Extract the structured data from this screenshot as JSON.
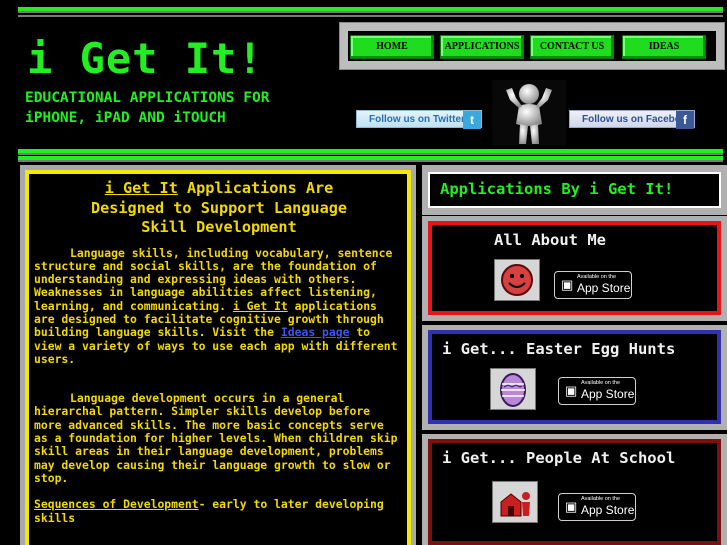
{
  "header": {
    "title": "i Get It!",
    "subtitle_line1": "EDUCATIONAL APPLICATIONS FOR",
    "subtitle_line2": "iPHONE, iPAD AND iTOUCH"
  },
  "nav": {
    "items": [
      {
        "label": "HOME"
      },
      {
        "label": "APPLICATIONS"
      },
      {
        "label": "CONTACT US"
      },
      {
        "label": "IDEAS"
      }
    ]
  },
  "social": {
    "twitter_label": "Follow us on Twitter",
    "facebook_label": "Follow us on Facebook"
  },
  "colors": {
    "accent_green": "#22ee22",
    "text_yellow": "#f1d900",
    "card_red": "#e8141c",
    "card_blue": "#3030b0",
    "card_darkred": "#7a1010"
  },
  "main": {
    "heading_brand": "i Get It",
    "heading_rest1": " Applications Are",
    "heading_line2": "Designed to Support Language",
    "heading_line3": "Skill Development",
    "p1_text": "Language skills, including vocabulary, sentence structure and social skills, are the foundation of understanding and expressing ideas with others.  Weaknesses in language abilities affect listening, learning, and communicating.",
    "p1_brand": "i Get It",
    "p1_text2": " applications are designed to facilitate cognitive growth through building language skills.  Visit the ",
    "p1_link": "Ideas page",
    "p1_text3": " to view a variety of ways to use each app with different users.",
    "p2_text": "Language development occurs in a general hierarchal pattern. Simpler skills develop before more advanced skills.  The more basic concepts serve as a foundation for higher levels.  When children skip skill areas in their language development, problems may develop causing their language growth to slow or stop.",
    "p3_link": "Sequences of Development",
    "p3_text": "- early to later developing skills"
  },
  "sidebar": {
    "header": "Applications By i Get It!",
    "apps": [
      {
        "title": "All About Me",
        "icon": "smiley-face-icon"
      },
      {
        "title": "i Get... Easter Egg Hunts",
        "icon": "easter-egg-icon"
      },
      {
        "title": "i Get... People At School",
        "icon": "school-icon"
      }
    ],
    "appstore_small": "Available on the",
    "appstore_big": "App Store"
  }
}
